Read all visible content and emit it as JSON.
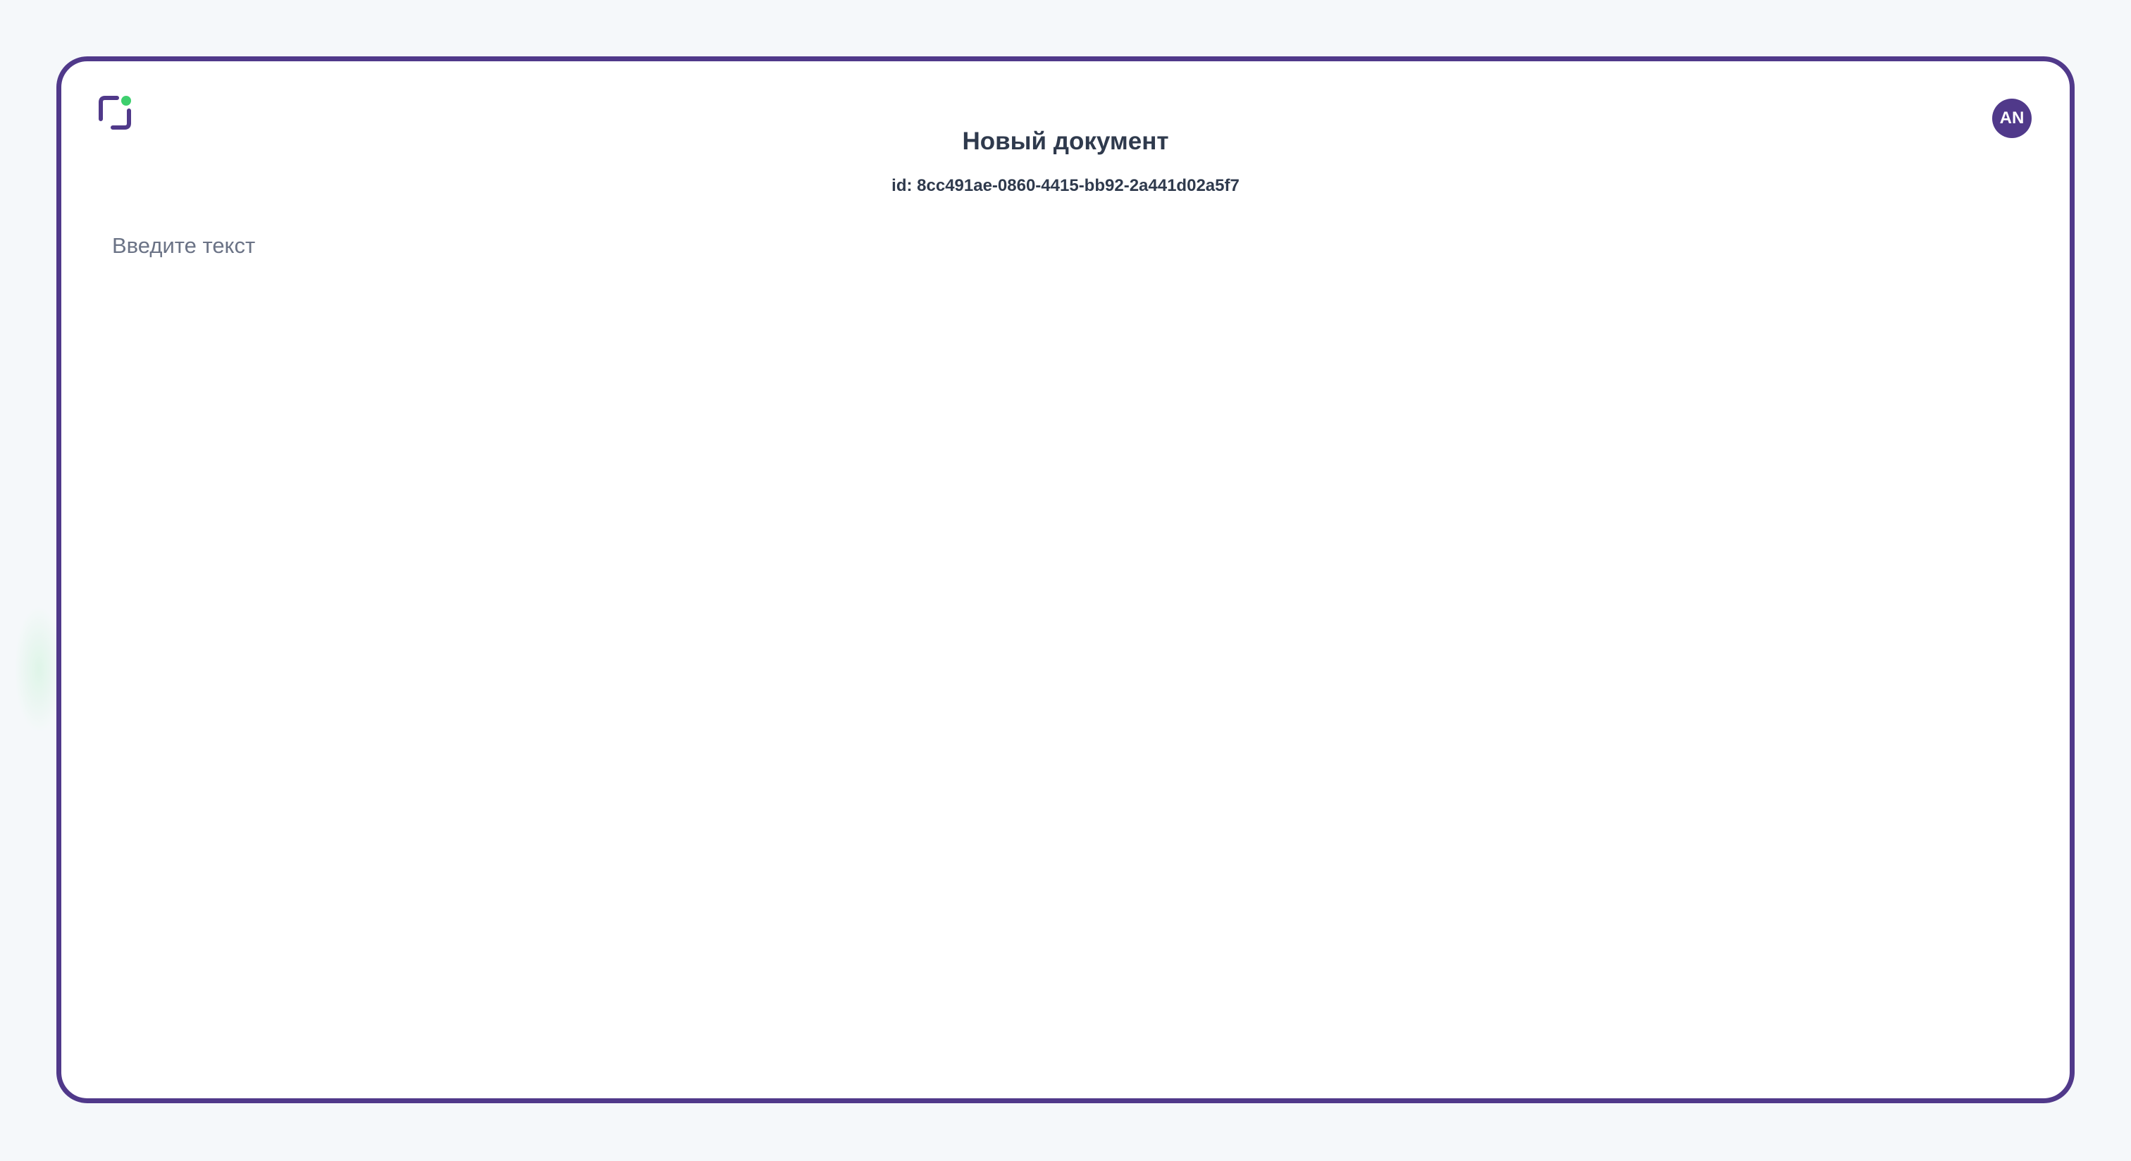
{
  "document": {
    "title": "Новый документ",
    "id_text": "id: 8cc491ae-0860-4415-bb92-2a441d02a5f7"
  },
  "editor": {
    "value": "",
    "placeholder": "Введите текст"
  },
  "user": {
    "initials": "AN"
  },
  "icons": {
    "logo": "app-logo-icon"
  },
  "colors": {
    "accent": "#50398a",
    "status_dot": "#3ecf6e",
    "text": "#2f3a4d",
    "placeholder": "#6b7386",
    "background": "#f5f8fa"
  }
}
